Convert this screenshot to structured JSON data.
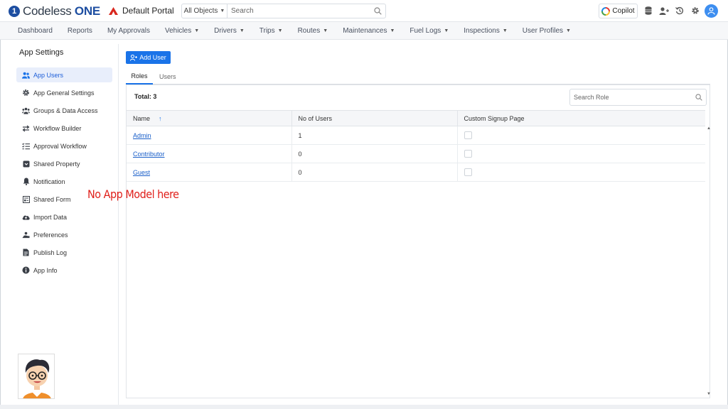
{
  "app": {
    "brand_mark": "1",
    "brand_name": "Codeless",
    "brand_suffix": "ONE",
    "portal_name": "Default Portal"
  },
  "search": {
    "scope_label": "All Objects",
    "placeholder": "Search"
  },
  "topbar": {
    "copilot_label": "Copilot",
    "icons": [
      "database-icon",
      "add-user-icon",
      "history-icon",
      "gear-icon",
      "user-avatar-icon"
    ]
  },
  "nav": {
    "items": [
      {
        "label": "Dashboard",
        "dropdown": false
      },
      {
        "label": "Reports",
        "dropdown": false
      },
      {
        "label": "My Approvals",
        "dropdown": false
      },
      {
        "label": "Vehicles",
        "dropdown": true
      },
      {
        "label": "Drivers",
        "dropdown": true
      },
      {
        "label": "Trips",
        "dropdown": true
      },
      {
        "label": "Routes",
        "dropdown": true
      },
      {
        "label": "Maintenances",
        "dropdown": true
      },
      {
        "label": "Fuel Logs",
        "dropdown": true
      },
      {
        "label": "Inspections",
        "dropdown": true
      },
      {
        "label": "User Profiles",
        "dropdown": true
      }
    ]
  },
  "sidebar": {
    "title": "App Settings",
    "items": [
      {
        "label": "App Users",
        "icon": "users-icon",
        "active": true
      },
      {
        "label": "App General Settings",
        "icon": "gear-icon",
        "active": false
      },
      {
        "label": "Groups & Data Access",
        "icon": "groups-icon",
        "active": false
      },
      {
        "label": "Workflow Builder",
        "icon": "arrows-icon",
        "active": false
      },
      {
        "label": "Approval Workflow",
        "icon": "checklist-icon",
        "active": false
      },
      {
        "label": "Shared Property",
        "icon": "shared-box-icon",
        "active": false
      },
      {
        "label": "Notification",
        "icon": "bell-icon",
        "active": false
      },
      {
        "label": "Shared Form",
        "icon": "form-icon",
        "active": false
      },
      {
        "label": "Import Data",
        "icon": "cloud-upload-icon",
        "active": false
      },
      {
        "label": "Preferences",
        "icon": "preferences-icon",
        "active": false
      },
      {
        "label": "Publish Log",
        "icon": "document-icon",
        "active": false
      },
      {
        "label": "App Info",
        "icon": "info-icon",
        "active": false
      }
    ]
  },
  "main": {
    "add_user_label": "Add User",
    "tabs": [
      {
        "label": "Roles",
        "active": true
      },
      {
        "label": "Users",
        "active": false
      }
    ],
    "total_label": "Total: 3",
    "role_search_placeholder": "Search Role",
    "table": {
      "columns": [
        "Name",
        "No of Users",
        "Custom Signup Page"
      ],
      "sort_column": "Name",
      "sort_direction": "ascending",
      "rows": [
        {
          "name": "Admin",
          "users": "1",
          "custom_signup": false
        },
        {
          "name": "Contributor",
          "users": "0",
          "custom_signup": false
        },
        {
          "name": "Guest",
          "users": "0",
          "custom_signup": false
        }
      ]
    }
  },
  "annotation": {
    "text": "No App Model here",
    "color": "#e0201b"
  },
  "colors": {
    "accent": "#1a73e8",
    "brand": "#1d4ea1",
    "active_bg": "#e8eefb"
  }
}
